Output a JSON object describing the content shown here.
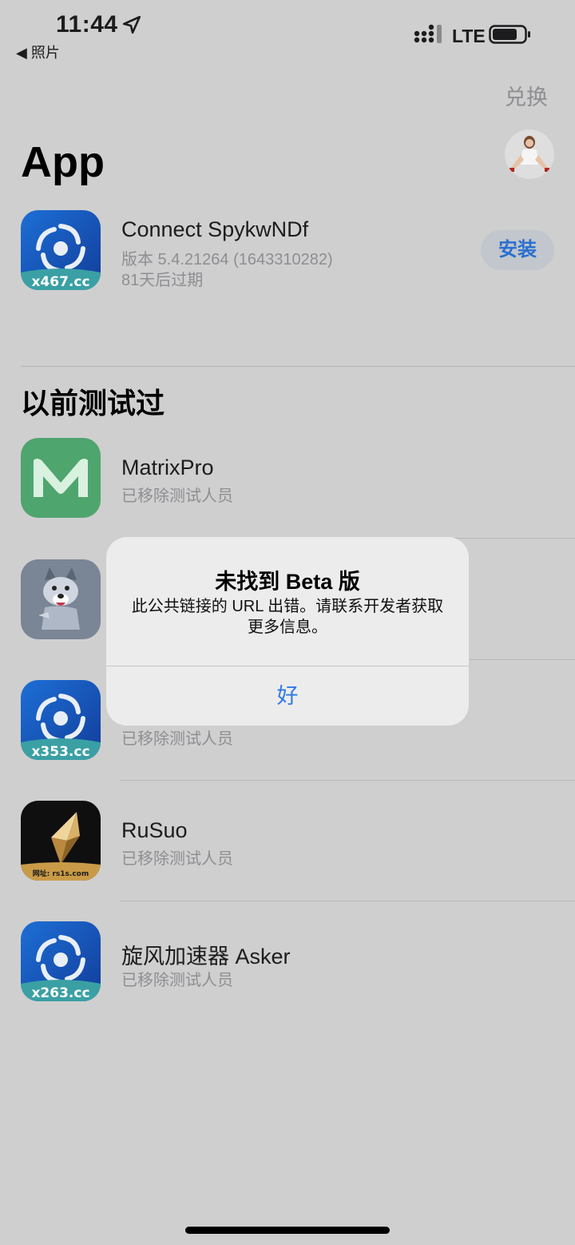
{
  "status_bar": {
    "time": "11:44",
    "back_label": "◀ 照片",
    "network": "LTE",
    "icons": [
      "location-arrow-icon",
      "signal-icon",
      "battery-icon"
    ]
  },
  "header": {
    "redeem_label": "兑换",
    "title": "App"
  },
  "current_app": {
    "name": "Connect SpykwNDf",
    "version": "版本 5.4.21264 (1643310282)",
    "expiry": "81天后过期",
    "icon_label": "x467.cc",
    "install_label": "安装"
  },
  "previous": {
    "title": "以前测试过",
    "apps": [
      {
        "name": "MatrixPro",
        "status": "已移除测试人员",
        "icon": "matrix-m-icon"
      },
      {
        "name": "",
        "status": "",
        "icon": "wolf-cartoon-icon"
      },
      {
        "name": "",
        "status": "已移除测试人员",
        "icon": "swirl-icon",
        "icon_label": "x353.cc"
      },
      {
        "name": "RuSuo",
        "status": "已移除测试人员",
        "icon": "diamond-icon",
        "icon_label": "网址: rs1s.com"
      },
      {
        "name": "旋风加速器 Asker",
        "status": "已移除测试人员",
        "icon": "swirl-icon",
        "icon_label": "x263.cc"
      }
    ]
  },
  "alert": {
    "title": "未找到 Beta 版",
    "message": "此公共链接的 URL 出错。请联系开发者获取更多信息。",
    "ok_label": "好"
  },
  "colors": {
    "accent": "#2f7ae5",
    "background": "#cfcfcf",
    "install_button_bg": "#c2c6cd"
  }
}
